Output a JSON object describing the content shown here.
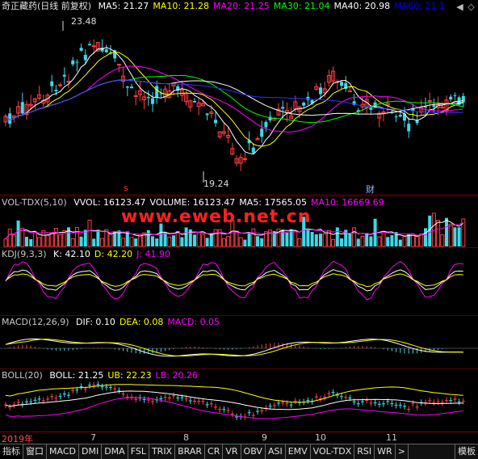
{
  "main": {
    "title": "奇正藏药(日线 前复权)",
    "ma": [
      {
        "label": "MA5: 21.27",
        "color": "#ffffff"
      },
      {
        "label": "MA10: 21.28",
        "color": "#ffff00"
      },
      {
        "label": "MA20: 21.25",
        "color": "#ff00ff"
      },
      {
        "label": "MA30: 21.04",
        "color": "#00ff00"
      },
      {
        "label": "MA40: 20.98",
        "color": "#ffffff"
      },
      {
        "label": "MA60: 21.1",
        "color": "#0000ff"
      }
    ],
    "high_label": "23.48",
    "low_label": "19.24",
    "event_marks": [
      "s",
      "财"
    ]
  },
  "volume": {
    "title": "VOL-TDX(5,10)",
    "values": [
      {
        "label": "VVOL: 16123.47",
        "color": "#ffffff"
      },
      {
        "label": "VOLUME: 16123.47",
        "color": "#ffffff"
      },
      {
        "label": "MA5: 17565.05",
        "color": "#ffffff"
      },
      {
        "label": "MA10: 16669.69",
        "color": "#ff00ff"
      }
    ]
  },
  "kdj": {
    "title": "KDJ(9,3,3)",
    "values": [
      {
        "label": "K: 42.10",
        "color": "#ffffff"
      },
      {
        "label": "D: 42.20",
        "color": "#ffff00"
      },
      {
        "label": "J: 41.90",
        "color": "#ff00ff"
      }
    ]
  },
  "macd": {
    "title": "MACD(12,26,9)",
    "values": [
      {
        "label": "DIF: 0.10",
        "color": "#ffffff"
      },
      {
        "label": "DEA: 0.08",
        "color": "#ffff00"
      },
      {
        "label": "MACD: 0.05",
        "color": "#ff00ff"
      }
    ]
  },
  "boll": {
    "title": "BOLL(20)",
    "values": [
      {
        "label": "BOLL: 21.25",
        "color": "#ffffff"
      },
      {
        "label": "UB: 22.23",
        "color": "#ffff00"
      },
      {
        "label": "LB: 20.26",
        "color": "#ff00ff"
      }
    ]
  },
  "watermark": "www.eweb.net.cn",
  "xaxis": [
    "2019年",
    "7",
    "8",
    "9",
    "10",
    "11"
  ],
  "tabs": [
    "指标",
    "窗口",
    "MACD",
    "DMI",
    "DMA",
    "FSL",
    "TRIX",
    "BRAR",
    "CR",
    "VR",
    "OBV",
    "ASI",
    "EMV",
    "VOL-TDX",
    "RSI",
    "WR",
    ">"
  ],
  "template_tab": "模板",
  "icons": {
    "left": "◀",
    "diamond": "◇"
  }
}
